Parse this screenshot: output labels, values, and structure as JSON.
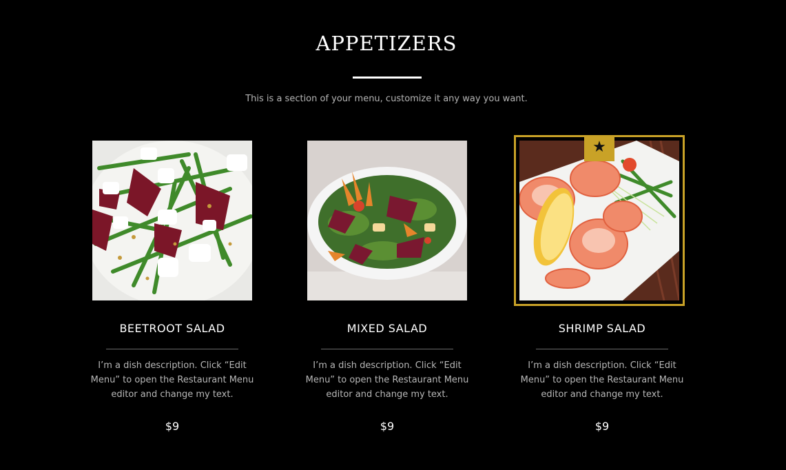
{
  "section": {
    "title": "APPETIZERS",
    "description": "This is a section of your menu, customize it any way you want."
  },
  "dishes": [
    {
      "name": "BEETROOT SALAD",
      "description": "I’m a dish description. Click “Edit Menu” to open the Restaurant Menu editor and change my text.",
      "price": "$9",
      "featured": false
    },
    {
      "name": "MIXED SALAD",
      "description": "I’m a dish description. Click “Edit Menu” to open the Restaurant Menu editor and change my text.",
      "price": "$9",
      "featured": false
    },
    {
      "name": "SHRIMP SALAD",
      "description": "I’m a dish description. Click “Edit Menu” to open the Restaurant Menu editor and change my text.",
      "price": "$9",
      "featured": true,
      "badge_icon": "star-icon",
      "badge_symbol": "★"
    }
  ],
  "colors": {
    "background": "#000000",
    "accent_gold": "#c9a227",
    "text_primary": "#ffffff",
    "text_secondary": "#b8b8b8"
  }
}
